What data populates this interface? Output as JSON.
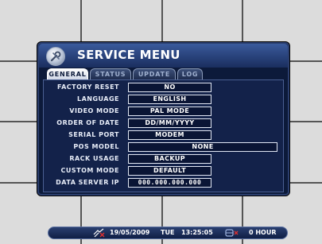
{
  "menu": {
    "title": "SERVICE MENU",
    "tabs": [
      {
        "label": "GENERAL",
        "active": true
      },
      {
        "label": "STATUS",
        "active": false
      },
      {
        "label": "UPDATE",
        "active": false
      },
      {
        "label": "LOG",
        "active": false
      }
    ],
    "rows": [
      {
        "label": "FACTORY RESET",
        "value": "NO"
      },
      {
        "label": "LANGUAGE",
        "value": "ENGLISH"
      },
      {
        "label": "VIDEO MODE",
        "value": "PAL MODE"
      },
      {
        "label": "ORDER OF DATE",
        "value": "DD/MM/YYYY"
      },
      {
        "label": "SERIAL PORT",
        "value": "MODEM"
      },
      {
        "label": "POS MODEL",
        "value": "NONE"
      },
      {
        "label": "RACK USAGE",
        "value": "BACKUP"
      },
      {
        "label": "CUSTOM MODE",
        "value": "DEFAULT"
      },
      {
        "label": "DATA SERVER IP",
        "value": "000.000.000.000"
      }
    ]
  },
  "statusbar": {
    "network_icon": "network-disconnected-icon",
    "date": "19/05/2009",
    "day": "TUE",
    "time": "13:25:05",
    "hdd_icon": "hdd-disconnected-icon",
    "hours": "0 HOUR"
  },
  "colors": {
    "background": "#dcdcdc",
    "dialog": "#0c1a3a",
    "panel": "#13224a",
    "title_gradient_top": "#3a5a9c",
    "active_tab": "#ffffff",
    "x_mark": "#e03030"
  }
}
